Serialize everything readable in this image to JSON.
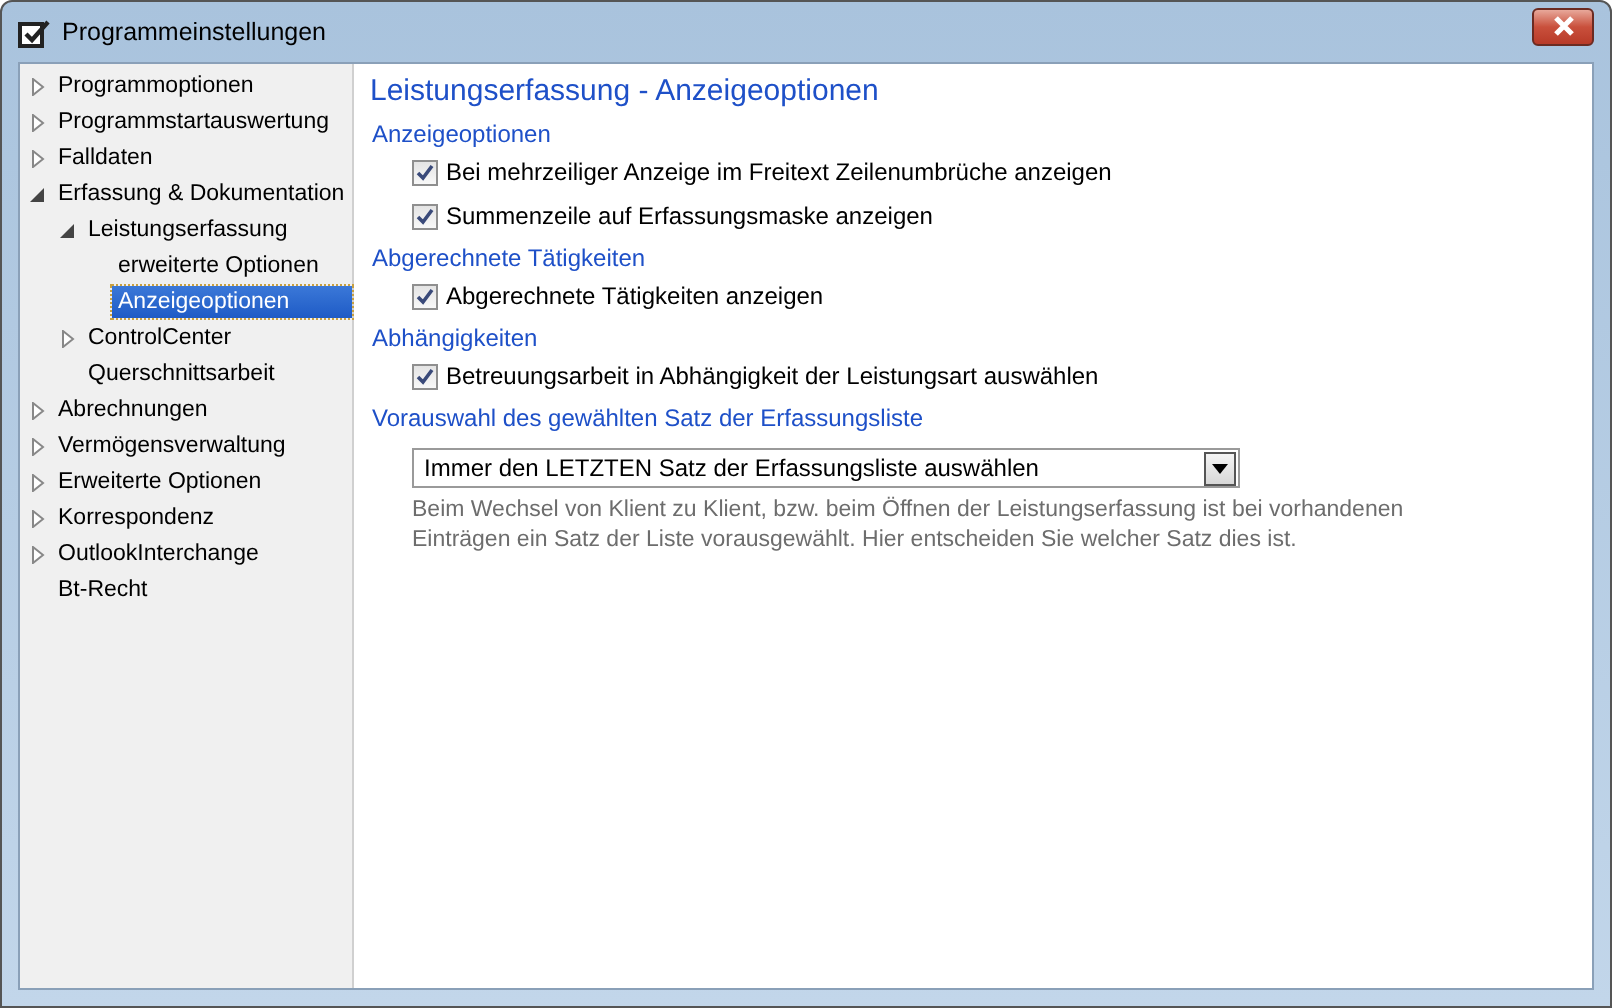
{
  "window": {
    "title": "Programmeinstellungen"
  },
  "sidebar": {
    "items": [
      {
        "label": "Programmoptionen",
        "expanded": false,
        "selected": false
      },
      {
        "label": "Programmstartauswertung",
        "expanded": false,
        "selected": false
      },
      {
        "label": "Falldaten",
        "expanded": false,
        "selected": false
      },
      {
        "label": "Erfassung & Dokumentation",
        "expanded": true,
        "selected": false,
        "children": [
          {
            "label": "Leistungserfassung",
            "expanded": true,
            "selected": false,
            "children": [
              {
                "label": "erweiterte Optionen",
                "selected": false
              },
              {
                "label": "Anzeigeoptionen",
                "selected": true
              }
            ]
          },
          {
            "label": "ControlCenter",
            "expanded": false,
            "selected": false
          },
          {
            "label": "Querschnittsarbeit",
            "selected": false
          }
        ]
      },
      {
        "label": "Abrechnungen",
        "expanded": false,
        "selected": false
      },
      {
        "label": "Vermögensverwaltung",
        "expanded": false,
        "selected": false
      },
      {
        "label": "Erweiterte Optionen",
        "expanded": false,
        "selected": false
      },
      {
        "label": "Korrespondenz",
        "expanded": false,
        "selected": false
      },
      {
        "label": "OutlookInterchange",
        "expanded": false,
        "selected": false
      },
      {
        "label": "Bt-Recht",
        "selected": false
      }
    ]
  },
  "page": {
    "title": "Leistungserfassung - Anzeigeoptionen",
    "sections": [
      {
        "heading": "Anzeigeoptionen",
        "options": [
          {
            "label": "Bei mehrzeiliger Anzeige im Freitext Zeilenumbrüche anzeigen",
            "checked": true
          },
          {
            "label": "Summenzeile auf Erfassungsmaske anzeigen",
            "checked": true
          }
        ]
      },
      {
        "heading": "Abgerechnete Tätigkeiten",
        "options": [
          {
            "label": "Abgerechnete Tätigkeiten anzeigen",
            "checked": true
          }
        ]
      },
      {
        "heading": "Abhängigkeiten",
        "options": [
          {
            "label": "Betreuungsarbeit in Abhängigkeit der Leistungsart auswählen",
            "checked": true
          }
        ]
      },
      {
        "heading": "Vorauswahl des gewählten Satz der Erfassungsliste",
        "dropdown": {
          "value": "Immer den LETZTEN Satz der Erfassungsliste auswählen"
        },
        "hint": "Beim Wechsel von Klient zu Klient, bzw. beim Öffnen der Leistungserfassung ist bei vorhandenen Einträgen ein Satz der Liste vorausgewählt. Hier entscheiden Sie welcher Satz dies ist."
      }
    ]
  }
}
